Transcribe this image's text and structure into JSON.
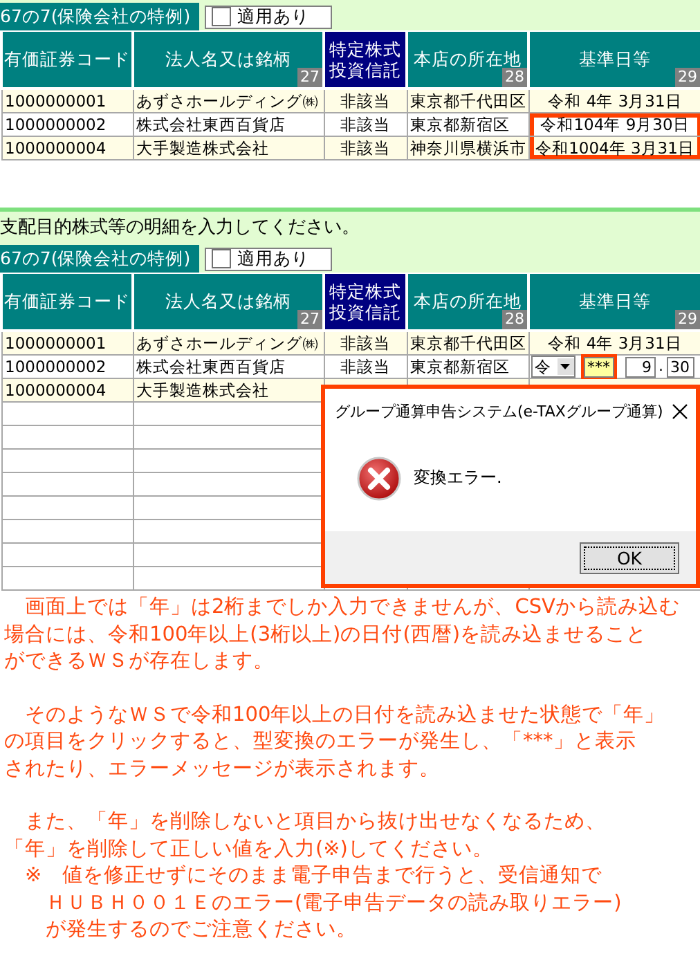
{
  "panels": [
    {
      "tab_label": "67の7(保険会社の特例)",
      "checkbox": {
        "label": "適用あり",
        "checked": false
      },
      "columns": [
        {
          "label": "有価証券コード",
          "kind": "plain"
        },
        {
          "label": "法人名又は銘柄",
          "kind": "numbered",
          "number": "27"
        },
        {
          "label": "特定株式投資信託",
          "kind": "special"
        },
        {
          "label": "本店の所在地",
          "kind": "numbered",
          "number": "28"
        },
        {
          "label": "基準日等",
          "kind": "numbered",
          "number": "29"
        }
      ],
      "rows": [
        {
          "code": "1000000001",
          "name": "あずさホールディング㈱",
          "special": "非該当",
          "address": "東京都千代田区",
          "date": {
            "kind": "text",
            "text": "令和 4年 3月31日",
            "highlighted": false
          }
        },
        {
          "code": "1000000002",
          "name": "株式会社東西百貨店",
          "special": "非該当",
          "address": "東京都新宿区",
          "date": {
            "kind": "text",
            "text": "令和104年 9月30日",
            "highlighted": true
          }
        },
        {
          "code": "1000000004",
          "name": "大手製造株式会社",
          "special": "非該当",
          "address": "神奈川県横浜市",
          "date": {
            "kind": "text",
            "text": "令和1004年 3月31日",
            "highlighted": true
          }
        }
      ]
    },
    {
      "instruction": "支配目的株式等の明細を入力してください。",
      "tab_label": "67の7(保険会社の特例)",
      "checkbox": {
        "label": "適用あり",
        "checked": false
      },
      "columns": [
        {
          "label": "有価証券コード",
          "kind": "plain"
        },
        {
          "label": "法人名又は銘柄",
          "kind": "numbered",
          "number": "27"
        },
        {
          "label": "特定株式投資信託",
          "kind": "special"
        },
        {
          "label": "本店の所在地",
          "kind": "numbered",
          "number": "28"
        },
        {
          "label": "基準日等",
          "kind": "numbered",
          "number": "29"
        }
      ],
      "rows": [
        {
          "code": "1000000001",
          "name": "あずさホールディング㈱",
          "special": "非該当",
          "address": "東京都千代田区",
          "date": {
            "kind": "text",
            "text": "令和 4年 3月31日",
            "highlighted": false
          }
        },
        {
          "code": "1000000002",
          "name": "株式会社東西百貨店",
          "special": "非該当",
          "address": "東京都新宿区",
          "date": {
            "kind": "editing",
            "era": "令",
            "year": "***",
            "month": "9",
            "separator": ".",
            "day": "30",
            "highlighted": true
          }
        },
        {
          "code": "1000000004",
          "name": "大手製造株式会社",
          "date": {
            "kind": "empty",
            "highlighted": false
          }
        }
      ],
      "dialog": {
        "title": "グループ通算申告システム(e-TAXグループ通算)",
        "message": "変換エラー.",
        "button": "OK"
      }
    }
  ],
  "notes": [
    {
      "lines": [
        "　画面上では「年」は2桁までしか入力できませんが、CSVから読み込む",
        "場合には、令和100年以上(3桁以上)の日付(西暦)を読み込ませること",
        "ができるＷＳが存在します。"
      ]
    },
    {
      "lines": [
        "　そのようなＷＳで令和100年以上の日付を読み込ませた状態で「年」",
        "の項目をクリックすると、型変換のエラーが発生し、「***」と表示",
        "されたり、エラーメッセージが表示されます。"
      ]
    },
    {
      "lines": [
        "　また、「年」を削除しないと項目から抜け出せなくなるため、",
        "「年」を削除して正しい値を入力(※)してください。",
        "　※　値を修正せずにそのまま電子申告まで行うと、受信通知で",
        "　　ＨＵＢＨ００１Ｅのエラー(電子申告データの読み取りエラー)",
        "　　が発生するのでご注意ください。"
      ]
    }
  ]
}
